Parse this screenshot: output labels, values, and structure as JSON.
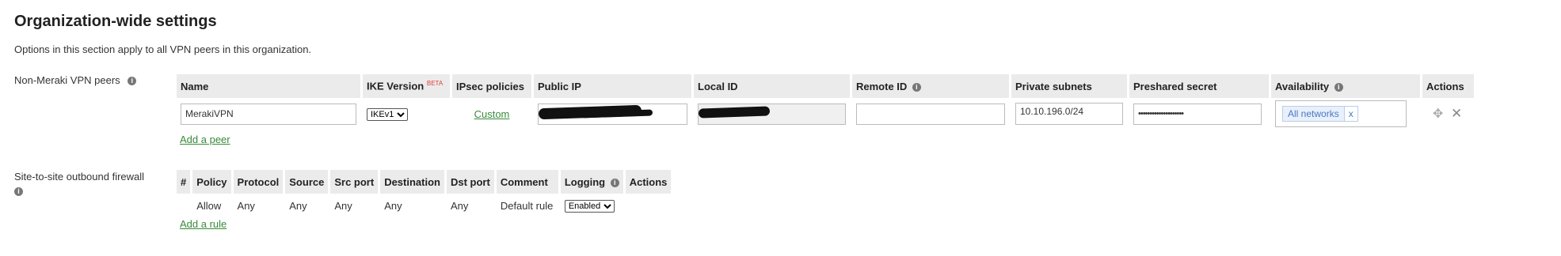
{
  "page": {
    "title": "Organization-wide settings",
    "description": "Options in this section apply to all VPN peers in this organization."
  },
  "vpn_peers": {
    "section_label": "Non-Meraki VPN peers",
    "columns": {
      "name": "Name",
      "ike_version": "IKE Version",
      "beta": "BETA",
      "ipsec": "IPsec policies",
      "public_ip": "Public IP",
      "local_id": "Local ID",
      "remote_id": "Remote ID",
      "private_subnets": "Private subnets",
      "preshared": "Preshared secret",
      "availability": "Availability",
      "actions": "Actions"
    },
    "row": {
      "name": "MerakiVPN",
      "ike_version": "IKEv1",
      "ipsec": "Custom",
      "remote_id": "",
      "private_subnets": "10.10.196.0/24",
      "preshared": "••••••••••••••••••••",
      "availability_tag": "All networks",
      "availability_remove": "x"
    },
    "add_link": "Add a peer"
  },
  "firewall": {
    "section_label": "Site-to-site outbound firewall",
    "columns": {
      "num": "#",
      "policy": "Policy",
      "protocol": "Protocol",
      "source": "Source",
      "src_port": "Src port",
      "destination": "Destination",
      "dst_port": "Dst port",
      "comment": "Comment",
      "logging": "Logging",
      "actions": "Actions"
    },
    "row": {
      "num": "",
      "policy": "Allow",
      "protocol": "Any",
      "source": "Any",
      "src_port": "Any",
      "destination": "Any",
      "dst_port": "Any",
      "comment": "Default rule",
      "logging": "Enabled"
    },
    "add_link": "Add a rule"
  },
  "icons": {
    "info": "info-icon",
    "move": "move-icon",
    "close": "close-icon"
  },
  "colors": {
    "link": "#3a8a3a",
    "header_bg": "#ebebeb",
    "chip": "#4a78c2",
    "beta": "#e04040"
  }
}
